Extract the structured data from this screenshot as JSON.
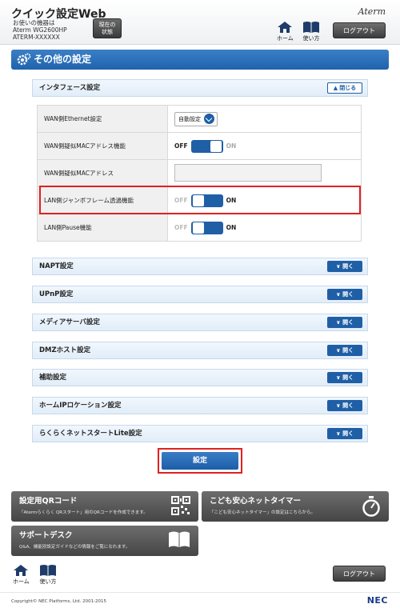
{
  "header": {
    "app_title": "クイック設定Web",
    "device_caption": "お使いの機器は",
    "device_model": "Aterm WG2600HP",
    "device_id": "ATERM-XXXXXX",
    "status_button_line1": "現在の",
    "status_button_line2": "状態",
    "brand": "Aterm",
    "home_label": "ホーム",
    "help_label": "使い方",
    "logout_label": "ログアウト"
  },
  "page_title": "その他の設定",
  "interface_section": {
    "title": "インタフェース設定",
    "close_label": "閉じる",
    "rows": [
      {
        "label": "WAN側Ethernet設定",
        "control": "select",
        "value": "自動設定"
      },
      {
        "label": "WAN側疑似MACアドレス機能",
        "control": "toggle",
        "off": "OFF",
        "on": "ON",
        "state": "off"
      },
      {
        "label": "WAN側疑似MACアドレス",
        "control": "input",
        "value": ""
      },
      {
        "label": "LAN側ジャンボフレーム透過機能",
        "control": "toggle",
        "off": "OFF",
        "on": "ON",
        "state": "on"
      },
      {
        "label": "LAN側Pause機能",
        "control": "toggle",
        "off": "OFF",
        "on": "ON",
        "state": "on"
      }
    ]
  },
  "sections": [
    {
      "title": "NAPT設定",
      "open_label": "開く"
    },
    {
      "title": "UPnP設定",
      "open_label": "開く"
    },
    {
      "title": "メディアサーバ設定",
      "open_label": "開く"
    },
    {
      "title": "DMZホスト設定",
      "open_label": "開く"
    },
    {
      "title": "補助設定",
      "open_label": "開く"
    },
    {
      "title": "ホームIPロケーション設定",
      "open_label": "開く"
    },
    {
      "title": "らくらくネットスタートLite設定",
      "open_label": "開く"
    }
  ],
  "save_label": "設定",
  "tiles": {
    "qr": {
      "title": "設定用QRコード",
      "desc": "「Atermらくらく QRスタート」用のQRコードを作成できます。"
    },
    "timer": {
      "title": "こども安心ネットタイマー",
      "desc": "「こども安心ネットタイマー」の設定はこちらから。"
    },
    "support": {
      "title": "サポートデスク",
      "desc": "Q&A、機能別設定ガイドなどの情報をご覧になれます。"
    }
  },
  "footer": {
    "home_label": "ホーム",
    "help_label": "使い方",
    "logout_label": "ログアウト",
    "copyright": "Copyright© NEC Platforms, Ltd. 2001-2015",
    "nec": "NEC"
  },
  "colors": {
    "accent_blue": "#1f5fa6",
    "highlight_red": "#e02020",
    "tile_gray": "#555555"
  }
}
